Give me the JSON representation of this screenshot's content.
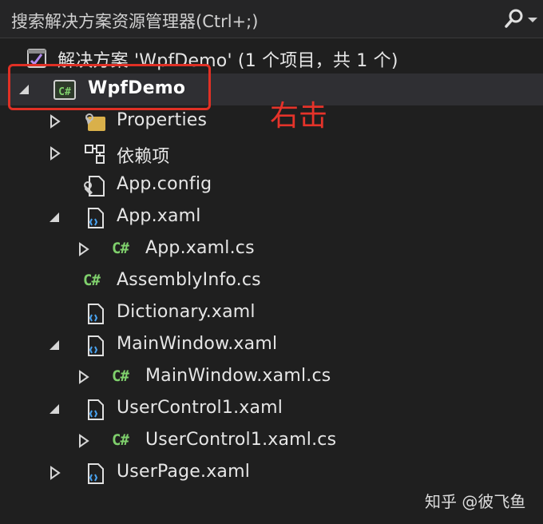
{
  "search": {
    "placeholder": "搜索解决方案资源管理器(Ctrl+;)"
  },
  "solution": {
    "label": "解决方案 'WpfDemo' (1 个项目，共 1 个)"
  },
  "tree": [
    {
      "label": "WpfDemo",
      "icon": "csharp-project-icon",
      "expander": "expanded"
    },
    {
      "label": "Properties",
      "icon": "properties-folder-icon",
      "expander": "collapsed"
    },
    {
      "label": "依赖项",
      "icon": "dependencies-icon",
      "expander": "collapsed"
    },
    {
      "label": "App.config",
      "icon": "config-file-icon",
      "expander": "none"
    },
    {
      "label": "App.xaml",
      "icon": "xaml-file-icon",
      "expander": "expanded"
    },
    {
      "label": "App.xaml.cs",
      "icon": "csharp-file-icon",
      "expander": "collapsed"
    },
    {
      "label": "AssemblyInfo.cs",
      "icon": "csharp-file-icon",
      "expander": "none"
    },
    {
      "label": "Dictionary.xaml",
      "icon": "xaml-file-icon",
      "expander": "none"
    },
    {
      "label": "MainWindow.xaml",
      "icon": "xaml-file-icon",
      "expander": "expanded"
    },
    {
      "label": "MainWindow.xaml.cs",
      "icon": "csharp-file-icon",
      "expander": "collapsed"
    },
    {
      "label": "UserControl1.xaml",
      "icon": "xaml-file-icon",
      "expander": "expanded"
    },
    {
      "label": "UserControl1.xaml.cs",
      "icon": "csharp-file-icon",
      "expander": "collapsed"
    },
    {
      "label": "UserPage.xaml",
      "icon": "xaml-file-icon",
      "expander": "collapsed"
    }
  ],
  "icons": {
    "csharp_glyph": "C#"
  },
  "annotation": {
    "text": "右击",
    "color": "#e5332a"
  },
  "watermark": {
    "text": "知乎 @彼飞鱼"
  },
  "colors": {
    "background": "#1f1f1f",
    "csharp_green": "#7fd06c",
    "highlight_red": "#e03025"
  }
}
